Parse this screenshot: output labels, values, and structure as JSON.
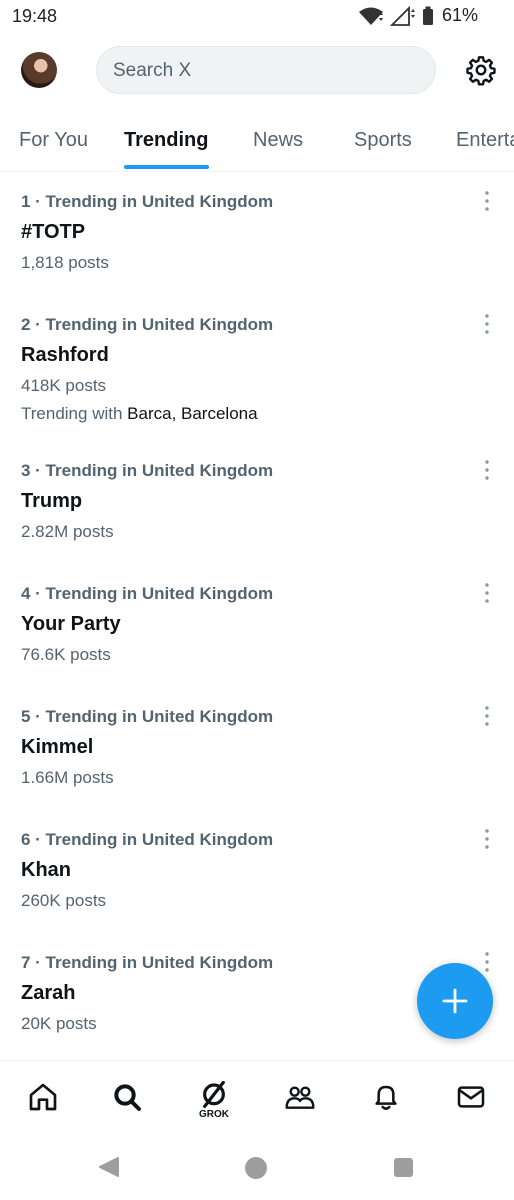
{
  "status_bar": {
    "time": "19:48",
    "battery": "61%",
    "icons": [
      "wifi-icon",
      "signal-icon",
      "battery-icon"
    ]
  },
  "header": {
    "search_placeholder": "Search X",
    "icons": [
      "avatar",
      "gear-icon"
    ]
  },
  "tabs": [
    {
      "label": "For You",
      "active": false
    },
    {
      "label": "Trending",
      "active": true
    },
    {
      "label": "News",
      "active": false
    },
    {
      "label": "Sports",
      "active": false
    },
    {
      "label": "Entertainment",
      "active": false
    }
  ],
  "trends": [
    {
      "meta": "1 · Trending in United Kingdom",
      "title": "#TOTP",
      "count": "1,818 posts"
    },
    {
      "meta": "2 · Trending in United Kingdom",
      "title": "Rashford",
      "count": "418K posts",
      "with_prefix": "Trending with ",
      "with_names": "Barca, Barcelona"
    },
    {
      "meta": "3 · Trending in United Kingdom",
      "title": "Trump",
      "count": "2.82M posts"
    },
    {
      "meta": "4 · Trending in United Kingdom",
      "title": "Your Party",
      "count": "76.6K posts"
    },
    {
      "meta": "5 · Trending in United Kingdom",
      "title": "Kimmel",
      "count": "1.66M posts"
    },
    {
      "meta": "6 · Trending in United Kingdom",
      "title": "Khan",
      "count": "260K posts"
    },
    {
      "meta": "7 · Trending in United Kingdom",
      "title": "Zarah",
      "count": "20K posts"
    }
  ],
  "bottom_nav": {
    "grok_label": "GROK",
    "icons": [
      "home-icon",
      "search-icon",
      "grok-icon",
      "communities-icon",
      "notifications-icon",
      "messages-icon"
    ]
  },
  "colors": {
    "accent": "#1d9bf0",
    "text_primary": "#0f1419",
    "text_secondary": "#536471"
  }
}
